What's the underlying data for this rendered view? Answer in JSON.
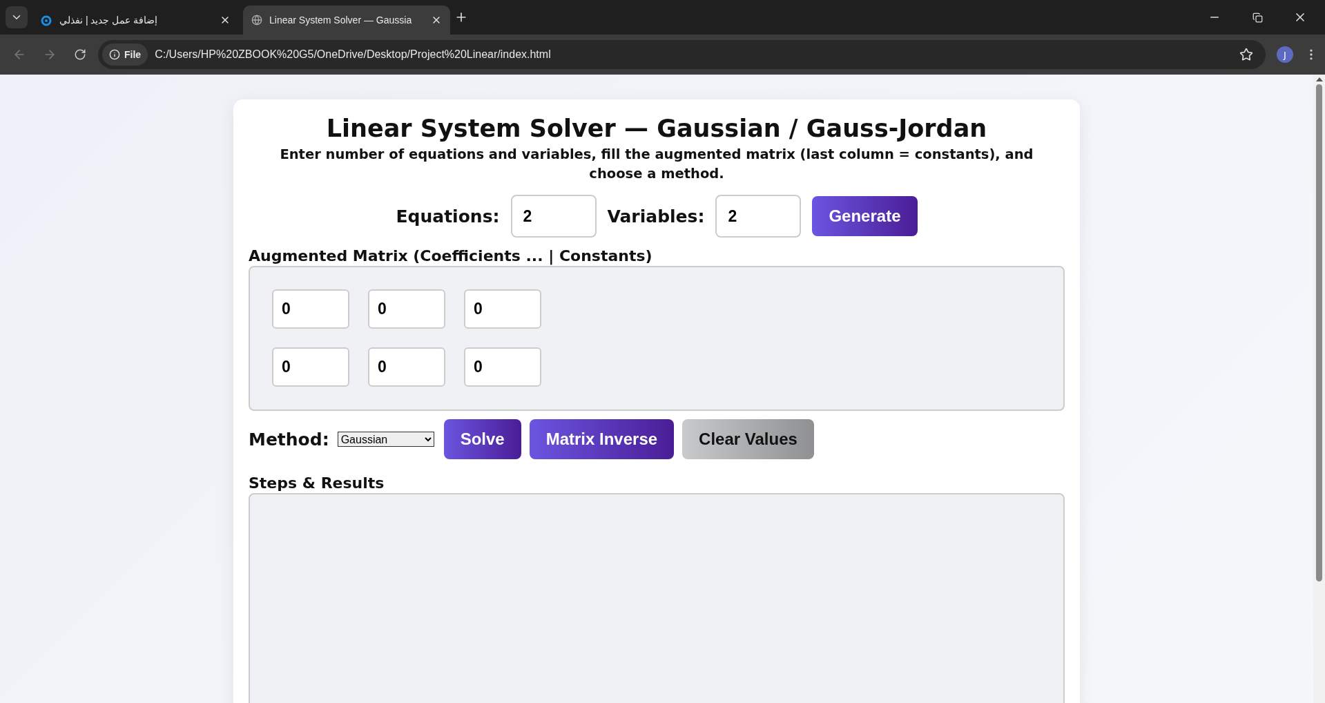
{
  "browser": {
    "tabs": [
      {
        "title": "إضافة عمل جديد | نفذلي",
        "selected": false,
        "kind": "site"
      },
      {
        "title": "Linear System Solver — Gaussia",
        "selected": true,
        "kind": "globe"
      }
    ],
    "address": {
      "chip": "File",
      "url": "C:/Users/HP%20ZBOOK%20G5/OneDrive/Desktop/Project%20Linear/index.html"
    },
    "avatar": "J"
  },
  "page": {
    "title": "Linear System Solver — Gaussian / Gauss-Jordan",
    "subtitle": "Enter number of equations and variables, fill the augmented matrix (last column = constants), and choose a method.",
    "fields": [
      {
        "label": "Equations:",
        "value": "2"
      },
      {
        "label": "Variables:",
        "value": "2"
      }
    ],
    "generate": "Generate",
    "matrix": {
      "label": "Augmented Matrix (Coefficients ... | Constants)",
      "rows": [
        [
          "0",
          "0",
          "0"
        ],
        [
          "0",
          "0",
          "0"
        ]
      ]
    },
    "method": {
      "label": "Method:",
      "value": "Gaussian"
    },
    "actions": [
      {
        "label": "Solve",
        "kind": "primary"
      },
      {
        "label": "Matrix Inverse",
        "kind": "primary"
      },
      {
        "label": "Clear Values",
        "kind": "secondary"
      }
    ],
    "results": {
      "label": "Steps & Results"
    }
  }
}
